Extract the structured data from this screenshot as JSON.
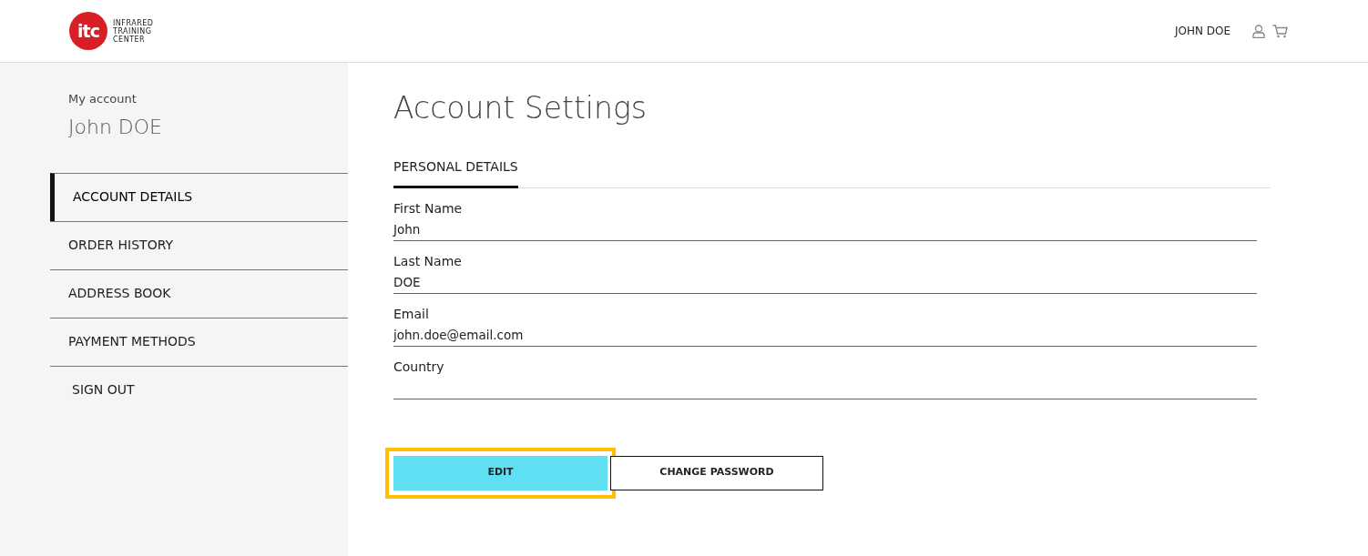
{
  "header": {
    "logo_mark": "itc",
    "logo_text": [
      "INFRARED",
      "TRAINING",
      "CENTER"
    ],
    "user_name": "JOHN DOE"
  },
  "sidebar": {
    "caption": "My account",
    "name": "John DOE",
    "items": [
      {
        "label": "ACCOUNT DETAILS",
        "selected": true
      },
      {
        "label": "ORDER HISTORY",
        "selected": false
      },
      {
        "label": "ADDRESS BOOK",
        "selected": false
      },
      {
        "label": "PAYMENT METHODS",
        "selected": false
      },
      {
        "label": "SIGN OUT",
        "selected": false
      }
    ]
  },
  "main": {
    "title": "Account Settings",
    "tabs": [
      {
        "label": "PERSONAL DETAILS",
        "selected": true
      }
    ],
    "fields": [
      {
        "label": "First Name",
        "value": "John"
      },
      {
        "label": "Last Name",
        "value": "DOE"
      },
      {
        "label": "Email",
        "value": "john.doe@email.com"
      },
      {
        "label": "Country"
      }
    ],
    "buttons": [
      {
        "label": "EDIT",
        "kind": "primary",
        "focused": true
      },
      {
        "label": "CHANGE PASSWORD",
        "kind": "outline",
        "focused": false
      }
    ]
  }
}
